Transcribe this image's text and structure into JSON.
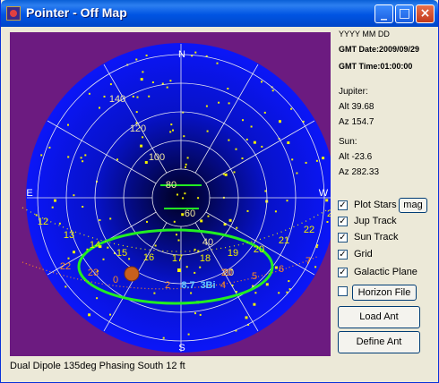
{
  "window": {
    "title": "Pointer - Off Map"
  },
  "colors": {
    "sky": "#0b16f8",
    "outer": "#6c1b80",
    "stars": "#f2f000",
    "galactic": "#22ee22",
    "jup_track": "#f2f000",
    "sun_track": "#ff8a1c"
  },
  "map": {
    "compass": {
      "n": "N",
      "s": "S",
      "e": "E",
      "w": "W"
    },
    "alt_labels": [
      "140",
      "120",
      "100",
      "80",
      "60",
      "40",
      "20"
    ],
    "jup_hours": [
      "12",
      "13",
      "14",
      "15",
      "16",
      "17",
      "18",
      "19",
      "20",
      "21",
      "22",
      "2"
    ],
    "sun_hours": [
      "22",
      "23",
      "0",
      "2",
      "4",
      "5",
      "6",
      "7",
      "20"
    ],
    "object_labels": {
      "sun_label": "8.7",
      "other_label": "3Bi"
    }
  },
  "sidebar": {
    "date_format": "YYYY MM DD",
    "gmt_date": "GMT Date:2009/09/29",
    "gmt_time": "GMT Time:01:00:00",
    "jupiter": {
      "name": "Jupiter:",
      "alt": "Alt 39.68",
      "az": "Az 154.7"
    },
    "sun": {
      "name": "Sun:",
      "alt": "Alt -23.6",
      "az": "Az 282.33"
    },
    "options": [
      {
        "label": "Plot Stars",
        "checked": true
      },
      {
        "label": "Jup Track",
        "checked": true
      },
      {
        "label": "Sun Track",
        "checked": true
      },
      {
        "label": "Grid",
        "checked": true
      },
      {
        "label": "Galactic Plane",
        "checked": true
      },
      {
        "label": "Horizon File",
        "checked": false
      }
    ],
    "mag_button": "mag",
    "load_button": "Load Ant",
    "define_button": "Define Ant"
  },
  "status": {
    "antenna": "Dual Dipole 135deg Phasing South 12 ft"
  }
}
